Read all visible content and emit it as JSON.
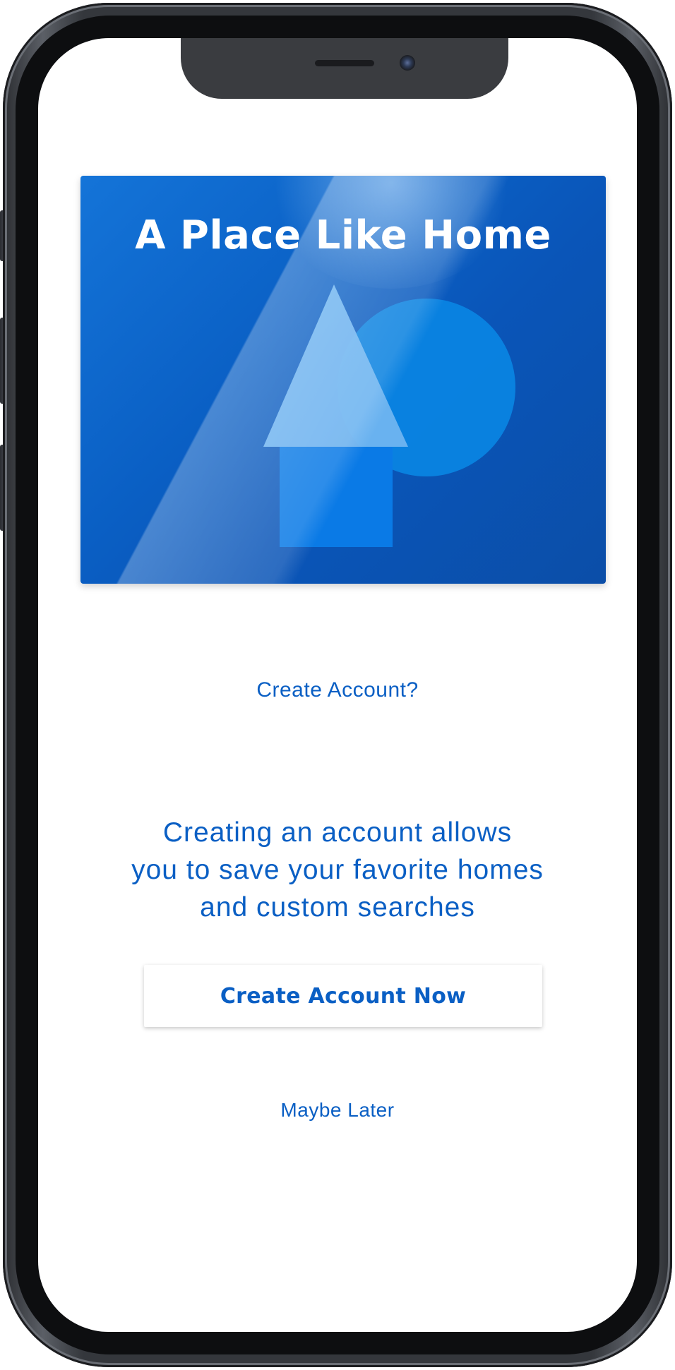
{
  "hero": {
    "title": "A Place Like Home"
  },
  "prompt": {
    "label": "Create Account?"
  },
  "description": {
    "line1": "Creating an account allows",
    "line2": "you to save your favorite homes",
    "line3": "and custom searches"
  },
  "buttons": {
    "create_now_label": "Create Account Now",
    "maybe_later_label": "Maybe Later"
  },
  "colors": {
    "accent": "#0a5fc4",
    "hero_blue": "#0a55b8",
    "roof": "#6db4f0",
    "house_body": "#0a7ae6",
    "circle": "#0a84e2"
  }
}
